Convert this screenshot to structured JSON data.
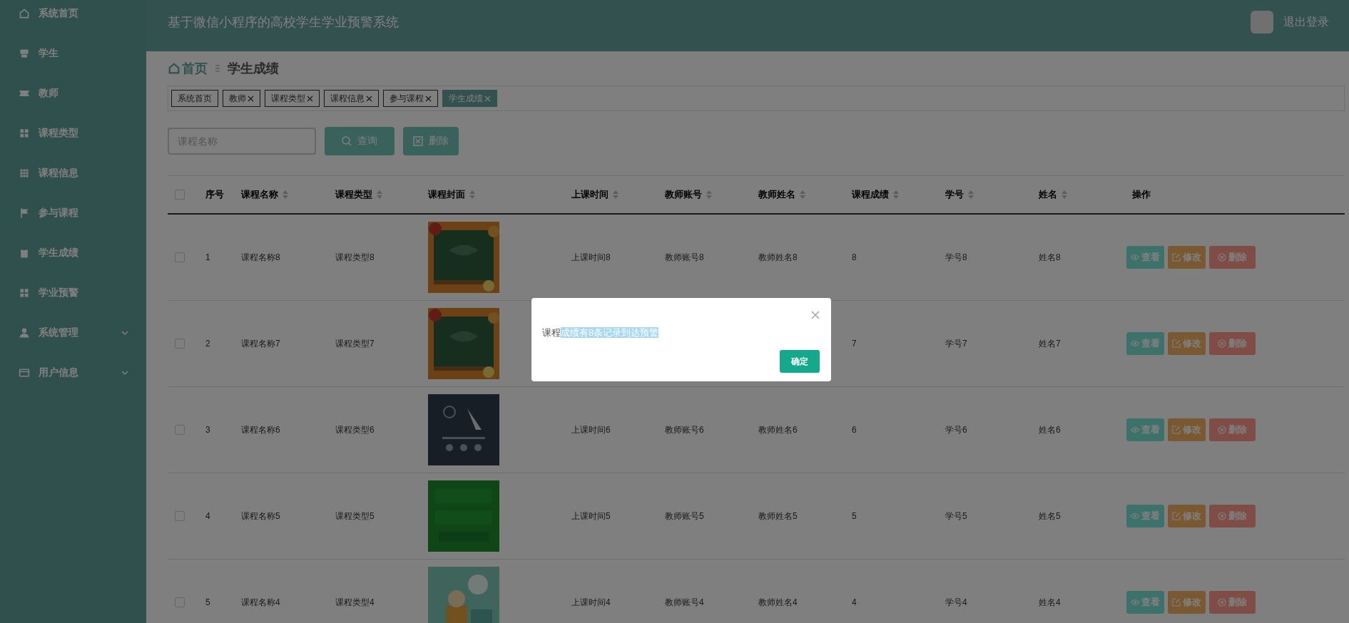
{
  "sidebar": {
    "items": [
      {
        "label": "系统首页",
        "has_submenu": false
      },
      {
        "label": "学生",
        "has_submenu": false
      },
      {
        "label": "教师",
        "has_submenu": false
      },
      {
        "label": "课程类型",
        "has_submenu": false
      },
      {
        "label": "课程信息",
        "has_submenu": false
      },
      {
        "label": "参与课程",
        "has_submenu": false
      },
      {
        "label": "学生成绩",
        "has_submenu": false
      },
      {
        "label": "学业预警",
        "has_submenu": false
      },
      {
        "label": "系统管理",
        "has_submenu": true
      },
      {
        "label": "用户信息",
        "has_submenu": true
      }
    ]
  },
  "header": {
    "title": "基于微信小程序的高校学生学业预警系统",
    "logout": "退出登录"
  },
  "breadcrumb": {
    "home": "首页",
    "current": "学生成绩"
  },
  "tabs": [
    {
      "label": "系统首页",
      "closable": false,
      "selected": false
    },
    {
      "label": "教师",
      "closable": true,
      "selected": false
    },
    {
      "label": "课程类型",
      "closable": true,
      "selected": false
    },
    {
      "label": "课程信息",
      "closable": true,
      "selected": false
    },
    {
      "label": "参与课程",
      "closable": true,
      "selected": false
    },
    {
      "label": "学生成绩",
      "closable": true,
      "selected": true
    }
  ],
  "search": {
    "placeholder": "课程名称"
  },
  "toolbar_buttons": [
    {
      "label": "查询",
      "kind": "search"
    },
    {
      "label": "删除",
      "kind": "delete"
    }
  ],
  "table": {
    "header_checked": false,
    "columns": [
      {
        "label": "序号",
        "sortable": false
      },
      {
        "label": "课程名称",
        "sortable": true
      },
      {
        "label": "课程类型",
        "sortable": true
      },
      {
        "label": "课程封面",
        "sortable": true
      },
      {
        "label": "上课时间",
        "sortable": true
      },
      {
        "label": "教师账号",
        "sortable": true
      },
      {
        "label": "教师姓名",
        "sortable": true
      },
      {
        "label": "课程成绩",
        "sortable": true
      },
      {
        "label": "学号",
        "sortable": true
      },
      {
        "label": "姓名",
        "sortable": true
      },
      {
        "label": "操作",
        "sortable": false
      }
    ],
    "rows": [
      {
        "checked": false,
        "cells": [
          "1",
          "课程名称8",
          "课程类型8",
          {
            "kind": "picture"
          },
          "上课时间8",
          "教师账号8",
          "教师姓名8",
          "8",
          "学号8",
          "姓名8"
        ],
        "actions": [
          {
            "label": "查看",
            "kind": "view"
          },
          {
            "label": "修改",
            "kind": "edit"
          },
          {
            "label": "删除",
            "kind": "delete"
          }
        ]
      },
      {
        "checked": false,
        "cells": [
          "2",
          "课程名称7",
          "课程类型7",
          {
            "kind": "picture"
          },
          null,
          null,
          null,
          "7",
          "学号7",
          "姓名7"
        ],
        "actions": [
          {
            "label": "查看",
            "kind": "view"
          },
          {
            "label": "修改",
            "kind": "edit"
          },
          {
            "label": "删除",
            "kind": "delete"
          }
        ]
      },
      {
        "checked": false,
        "cells": [
          "3",
          "课程名称6",
          "课程类型6",
          {
            "kind": "picture"
          },
          "上课时间6",
          "教师账号6",
          "教师姓名6",
          "6",
          "学号6",
          "姓名6"
        ],
        "actions": [
          {
            "label": "查看",
            "kind": "view"
          },
          {
            "label": "修改",
            "kind": "edit"
          },
          {
            "label": "删除",
            "kind": "delete"
          }
        ]
      },
      {
        "checked": false,
        "cells": [
          "4",
          "课程名称5",
          "课程类型5",
          {
            "kind": "picture"
          },
          "上课时间5",
          "教师账号5",
          "教师姓名5",
          "5",
          "学号5",
          "姓名5"
        ],
        "actions": [
          {
            "label": "查看",
            "kind": "view"
          },
          {
            "label": "修改",
            "kind": "edit"
          },
          {
            "label": "删除",
            "kind": "delete"
          }
        ]
      },
      {
        "checked": false,
        "cells": [
          "5",
          "课程名称4",
          "课程类型4",
          {
            "kind": "picture"
          },
          "上课时间4",
          "教师账号4",
          "教师姓名4",
          "4",
          "学号4",
          "姓名4"
        ],
        "actions": [
          {
            "label": "查看",
            "kind": "view"
          },
          {
            "label": "修改",
            "kind": "edit"
          },
          {
            "label": "删除",
            "kind": "delete"
          }
        ]
      }
    ]
  },
  "dialog": {
    "message_parts": [
      {
        "text": "课程",
        "highlighted": false
      },
      {
        "text": "成绩有8条记录到达预警",
        "highlighted": true
      }
    ],
    "confirm": "确定"
  }
}
